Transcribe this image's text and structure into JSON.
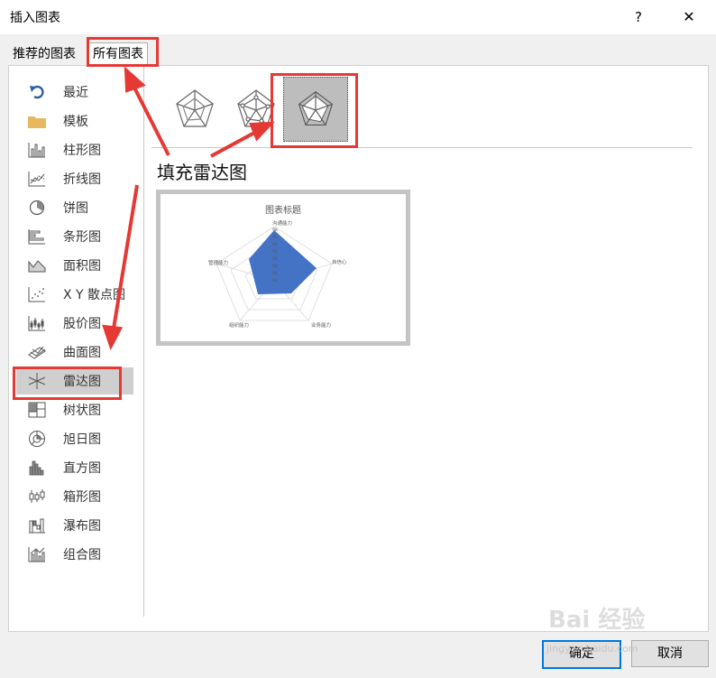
{
  "window": {
    "title": "插入图表",
    "help": "?",
    "close": "✕"
  },
  "tabs": [
    {
      "label": "推荐的图表"
    },
    {
      "label": "所有图表"
    }
  ],
  "sidebar": {
    "items": [
      {
        "label": "最近",
        "icon": "undo-arrow-icon"
      },
      {
        "label": "模板",
        "icon": "folder-icon"
      },
      {
        "label": "柱形图",
        "icon": "column-chart-icon"
      },
      {
        "label": "折线图",
        "icon": "line-chart-icon"
      },
      {
        "label": "饼图",
        "icon": "pie-chart-icon"
      },
      {
        "label": "条形图",
        "icon": "bar-chart-icon"
      },
      {
        "label": "面积图",
        "icon": "area-chart-icon"
      },
      {
        "label": "X Y 散点图",
        "icon": "scatter-chart-icon"
      },
      {
        "label": "股价图",
        "icon": "stock-chart-icon"
      },
      {
        "label": "曲面图",
        "icon": "surface-chart-icon"
      },
      {
        "label": "雷达图",
        "icon": "radar-chart-icon"
      },
      {
        "label": "树状图",
        "icon": "treemap-chart-icon"
      },
      {
        "label": "旭日图",
        "icon": "sunburst-chart-icon"
      },
      {
        "label": "直方图",
        "icon": "histogram-chart-icon"
      },
      {
        "label": "箱形图",
        "icon": "box-whisker-chart-icon"
      },
      {
        "label": "瀑布图",
        "icon": "waterfall-chart-icon"
      },
      {
        "label": "组合图",
        "icon": "combo-chart-icon"
      }
    ],
    "selected": "雷达图"
  },
  "main": {
    "subtypes": [
      "radar",
      "radar-with-markers",
      "filled-radar"
    ],
    "selected_subtype": "filled-radar",
    "subtype_title": "填充雷达图",
    "preview": {
      "title": "图表标题",
      "axis_labels": [
        "沟通能力",
        "自信心",
        "业务能力",
        "组织能力",
        "管理能力"
      ],
      "tick_labels": [
        "98",
        "96",
        "94",
        "92",
        "90",
        "88",
        "86",
        "84"
      ],
      "fill_color": "#4472c4"
    }
  },
  "buttons": {
    "ok": "确定",
    "cancel": "取消"
  },
  "watermark": {
    "logo": "Bai 经验",
    "url": "jingyan.baidu.com"
  },
  "colors": {
    "annotation": "#e53935",
    "accent": "#0078d7"
  }
}
